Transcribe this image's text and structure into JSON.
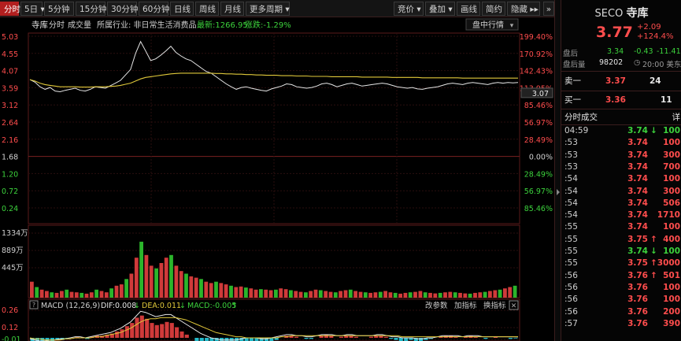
{
  "toolbar": {
    "tabs_left": [
      {
        "label": "分时",
        "active": true
      },
      {
        "label": "5日 ▾"
      },
      {
        "label": "5分钟"
      },
      {
        "label": "15分钟"
      },
      {
        "label": "30分钟"
      },
      {
        "label": "60分钟"
      },
      {
        "label": "日线"
      },
      {
        "label": "周线"
      },
      {
        "label": "月线"
      },
      {
        "label": "更多周期 ▾"
      }
    ],
    "tabs_right": [
      {
        "label": "竞价 ▾"
      },
      {
        "label": "叠加 ▾"
      },
      {
        "label": "画线"
      },
      {
        "label": "简约"
      },
      {
        "label": "隐藏 ▸▸"
      }
    ],
    "nav_icon": "double-chevron-right-icon"
  },
  "info_bar": {
    "name": "寺库",
    "mode1": "分时",
    "mode2": "成交量",
    "industry": "所属行业: 非日常生活消费品",
    "latest": "最新:1266.95",
    "change": "涨跌:-1.29%",
    "dropdown": "盘中行情"
  },
  "price_axis": {
    "left_labels": [
      "5.03",
      "4.55",
      "4.07",
      "3.59",
      "3.12",
      "2.64",
      "2.16",
      "1.68",
      "1.20",
      "0.72",
      "0.24"
    ],
    "right_labels": [
      "199.40%",
      "170.92%",
      "142.43%",
      "113.95%",
      "85.46%",
      "56.97%",
      "28.49%",
      "0.00%",
      "28.49%",
      "56.97%",
      "85.46%"
    ],
    "current_price_tag": "3.07",
    "base_price": 1.68,
    "top_price": 5.03,
    "bottom_price": 0.24
  },
  "volume_axis": {
    "labels": [
      "1334万",
      "889万",
      "445万"
    ]
  },
  "macd": {
    "params": "MACD (12,26,9)",
    "dif": "DIF:0.008",
    "dea": "DEA:0.011",
    "macd_value": "MACD:-0.005",
    "buttons": [
      "改参数",
      "加指标",
      "换指标"
    ],
    "close": "✕",
    "axis_labels": [
      "0.26",
      "0.12",
      "-0.01"
    ]
  },
  "chart_data": {
    "type": "line",
    "title": "",
    "series": [
      {
        "name": "",
        "color": "#e6e6e6",
        "values": [
          3.82,
          3.75,
          3.62,
          3.55,
          3.6,
          3.5,
          3.48,
          3.52,
          3.55,
          3.58,
          3.52,
          3.5,
          3.55,
          3.62,
          3.6,
          3.58,
          3.65,
          3.72,
          3.8,
          3.95,
          4.1,
          4.55,
          4.88,
          4.62,
          4.35,
          4.4,
          4.5,
          4.62,
          4.75,
          4.58,
          4.48,
          4.4,
          4.35,
          4.25,
          4.15,
          4.05,
          4.0,
          3.9,
          3.8,
          3.7,
          3.62,
          3.55,
          3.6,
          3.62,
          3.58,
          3.55,
          3.52,
          3.5,
          3.56,
          3.6,
          3.64,
          3.7,
          3.68,
          3.62,
          3.6,
          3.58,
          3.6,
          3.64,
          3.7,
          3.72,
          3.68,
          3.62,
          3.66,
          3.7,
          3.72,
          3.68,
          3.64,
          3.66,
          3.68,
          3.7,
          3.72,
          3.7,
          3.66,
          3.62,
          3.6,
          3.58,
          3.6,
          3.56,
          3.55,
          3.58,
          3.6,
          3.62,
          3.66,
          3.7,
          3.72,
          3.7,
          3.68,
          3.72,
          3.74,
          3.72,
          3.7,
          3.68,
          3.72,
          3.74,
          3.72,
          3.74,
          3.73,
          3.74
        ]
      },
      {
        "name": "",
        "color": "#e0c83a",
        "values": [
          3.82,
          3.78,
          3.72,
          3.68,
          3.66,
          3.64,
          3.62,
          3.62,
          3.62,
          3.62,
          3.61,
          3.61,
          3.61,
          3.62,
          3.62,
          3.62,
          3.63,
          3.64,
          3.66,
          3.69,
          3.72,
          3.78,
          3.84,
          3.88,
          3.9,
          3.92,
          3.94,
          3.96,
          3.98,
          3.99,
          4.0,
          4.0,
          4.0,
          4.0,
          4.0,
          4.0,
          4.0,
          3.99,
          3.99,
          3.98,
          3.98,
          3.97,
          3.97,
          3.96,
          3.96,
          3.95,
          3.95,
          3.94,
          3.94,
          3.94,
          3.93,
          3.93,
          3.93,
          3.92,
          3.92,
          3.92,
          3.91,
          3.91,
          3.91,
          3.91,
          3.9,
          3.9,
          3.9,
          3.9,
          3.9,
          3.9,
          3.89,
          3.89,
          3.89,
          3.89,
          3.89,
          3.89,
          3.88,
          3.88,
          3.88,
          3.88,
          3.88,
          3.88,
          3.87,
          3.87,
          3.87,
          3.87,
          3.87,
          3.87,
          3.87,
          3.87,
          3.86,
          3.86,
          3.86,
          3.86,
          3.86,
          3.86,
          3.86,
          3.86,
          3.86,
          3.86,
          3.86,
          3.86
        ]
      }
    ],
    "volume": [
      60,
      40,
      30,
      25,
      20,
      18,
      25,
      30,
      22,
      20,
      18,
      15,
      20,
      30,
      25,
      20,
      35,
      45,
      50,
      70,
      90,
      150,
      210,
      160,
      120,
      110,
      130,
      150,
      160,
      120,
      100,
      90,
      80,
      75,
      70,
      60,
      55,
      60,
      55,
      50,
      45,
      40,
      42,
      38,
      35,
      30,
      32,
      30,
      28,
      30,
      35,
      32,
      28,
      25,
      22,
      20,
      25,
      30,
      28,
      25,
      22,
      20,
      25,
      28,
      30,
      25,
      22,
      20,
      18,
      20,
      22,
      25,
      20,
      18,
      15,
      18,
      20,
      22,
      25,
      20,
      18,
      16,
      18,
      20,
      22,
      20,
      18,
      16,
      15,
      18,
      20,
      22,
      25,
      28,
      30,
      35,
      40,
      45
    ],
    "volume_max": 1334,
    "macd_hist": [
      -0.03,
      -0.04,
      -0.05,
      -0.04,
      -0.03,
      -0.02,
      -0.02,
      -0.01,
      0.0,
      0.01,
      0.0,
      -0.01,
      0.01,
      0.02,
      0.02,
      0.03,
      0.04,
      0.06,
      0.08,
      0.11,
      0.14,
      0.19,
      0.21,
      0.18,
      0.14,
      0.12,
      0.13,
      0.15,
      0.14,
      0.1,
      0.06,
      0.03,
      0.0,
      -0.03,
      -0.06,
      -0.08,
      -0.09,
      -0.1,
      -0.11,
      -0.1,
      -0.09,
      -0.08,
      -0.06,
      -0.04,
      -0.03,
      -0.03,
      -0.04,
      -0.05,
      -0.03,
      -0.02,
      0.0,
      0.02,
      0.02,
      0.01,
      0.0,
      -0.01,
      -0.01,
      0.0,
      0.02,
      0.03,
      0.02,
      0.0,
      0.01,
      0.02,
      0.02,
      0.01,
      0.0,
      0.0,
      0.01,
      0.02,
      0.02,
      0.01,
      -0.01,
      -0.02,
      -0.03,
      -0.03,
      -0.02,
      -0.03,
      -0.03,
      -0.02,
      -0.01,
      0.0,
      0.01,
      0.02,
      0.02,
      0.01,
      0.0,
      0.01,
      0.02,
      0.01,
      0.0,
      -0.01,
      0.0,
      0.01,
      0.0,
      0.0,
      -0.01,
      -0.005
    ],
    "macd_dif": [
      -0.01,
      -0.02,
      -0.03,
      -0.03,
      -0.02,
      -0.02,
      -0.01,
      -0.01,
      0.0,
      0.01,
      0.01,
      0.0,
      0.01,
      0.02,
      0.03,
      0.04,
      0.05,
      0.07,
      0.09,
      0.12,
      0.15,
      0.2,
      0.25,
      0.24,
      0.22,
      0.2,
      0.21,
      0.22,
      0.22,
      0.19,
      0.16,
      0.13,
      0.1,
      0.07,
      0.04,
      0.02,
      0.0,
      -0.01,
      -0.02,
      -0.02,
      -0.02,
      -0.02,
      -0.01,
      0.0,
      0.0,
      0.0,
      -0.01,
      -0.01,
      0.0,
      0.01,
      0.02,
      0.03,
      0.03,
      0.02,
      0.02,
      0.01,
      0.01,
      0.02,
      0.03,
      0.03,
      0.03,
      0.02,
      0.02,
      0.03,
      0.03,
      0.02,
      0.02,
      0.02,
      0.02,
      0.03,
      0.03,
      0.02,
      0.01,
      0.01,
      0.0,
      0.0,
      0.0,
      -0.01,
      -0.01,
      0.0,
      0.0,
      0.01,
      0.02,
      0.02,
      0.02,
      0.02,
      0.01,
      0.02,
      0.02,
      0.02,
      0.01,
      0.01,
      0.01,
      0.01,
      0.01,
      0.01,
      0.01,
      0.008
    ],
    "macd_dea": [
      0.0,
      -0.01,
      -0.01,
      -0.02,
      -0.02,
      -0.02,
      -0.02,
      -0.01,
      -0.01,
      0.0,
      0.0,
      0.0,
      0.0,
      0.01,
      0.01,
      0.02,
      0.03,
      0.04,
      0.05,
      0.07,
      0.09,
      0.12,
      0.15,
      0.17,
      0.18,
      0.18,
      0.19,
      0.19,
      0.19,
      0.19,
      0.18,
      0.17,
      0.15,
      0.13,
      0.11,
      0.09,
      0.07,
      0.05,
      0.04,
      0.03,
      0.02,
      0.01,
      0.01,
      0.0,
      0.0,
      0.0,
      0.0,
      0.0,
      0.0,
      0.0,
      0.01,
      0.01,
      0.02,
      0.02,
      0.02,
      0.02,
      0.02,
      0.02,
      0.02,
      0.02,
      0.02,
      0.02,
      0.02,
      0.02,
      0.02,
      0.02,
      0.02,
      0.02,
      0.02,
      0.02,
      0.02,
      0.02,
      0.02,
      0.02,
      0.01,
      0.01,
      0.01,
      0.01,
      0.01,
      0.01,
      0.01,
      0.01,
      0.01,
      0.01,
      0.01,
      0.01,
      0.01,
      0.01,
      0.01,
      0.01,
      0.01,
      0.01,
      0.01,
      0.01,
      0.01,
      0.01,
      0.01,
      0.011
    ]
  },
  "panel": {
    "symbol": "SECO",
    "name": "寺库",
    "price": "3.77",
    "change": "+2.09",
    "change_pct": "+124.4%",
    "after_label": "盘后",
    "after_price": "3.34",
    "after_change": "-0.43",
    "after_pct": "-11.41%",
    "after_vol_label": "盘后量",
    "after_vol": "98202",
    "time_text": "20:00 美东",
    "ask_label": "卖一",
    "ask_price": "3.37",
    "ask_qty": "24",
    "bid_label": "买一",
    "bid_price": "3.36",
    "bid_qty": "11",
    "trades_title": "分时成交",
    "trades_more": "详",
    "trades": [
      {
        "t": "04:59",
        "p": "3.74",
        "a": "↓",
        "v": "100",
        "c": "green"
      },
      {
        "t": ":53",
        "p": "3.74",
        "a": "",
        "v": "100",
        "c": "red"
      },
      {
        "t": ":53",
        "p": "3.74",
        "a": "",
        "v": "300",
        "c": "red"
      },
      {
        "t": ":53",
        "p": "3.74",
        "a": "",
        "v": "700",
        "c": "red"
      },
      {
        "t": ":54",
        "p": "3.74",
        "a": "",
        "v": "100",
        "c": "red"
      },
      {
        "t": ":54",
        "p": "3.74",
        "a": "",
        "v": "300",
        "c": "red"
      },
      {
        "t": ":54",
        "p": "3.74",
        "a": "",
        "v": "506",
        "c": "red"
      },
      {
        "t": ":54",
        "p": "3.74",
        "a": "",
        "v": "1710",
        "c": "red"
      },
      {
        "t": ":55",
        "p": "3.74",
        "a": "",
        "v": "100",
        "c": "red"
      },
      {
        "t": ":55",
        "p": "3.75",
        "a": "↑",
        "v": "400",
        "c": "red"
      },
      {
        "t": ":55",
        "p": "3.74",
        "a": "↓",
        "v": "100",
        "c": "green"
      },
      {
        "t": ":55",
        "p": "3.75",
        "a": "↑",
        "v": "3000",
        "c": "red"
      },
      {
        "t": ":56",
        "p": "3.76",
        "a": "↑",
        "v": "501",
        "c": "red"
      },
      {
        "t": ":56",
        "p": "3.76",
        "a": "",
        "v": "100",
        "c": "red"
      },
      {
        "t": ":56",
        "p": "3.76",
        "a": "",
        "v": "100",
        "c": "red"
      },
      {
        "t": ":56",
        "p": "3.76",
        "a": "",
        "v": "200",
        "c": "red"
      },
      {
        "t": ":57",
        "p": "3.76",
        "a": "",
        "v": "390",
        "c": "red"
      }
    ]
  }
}
